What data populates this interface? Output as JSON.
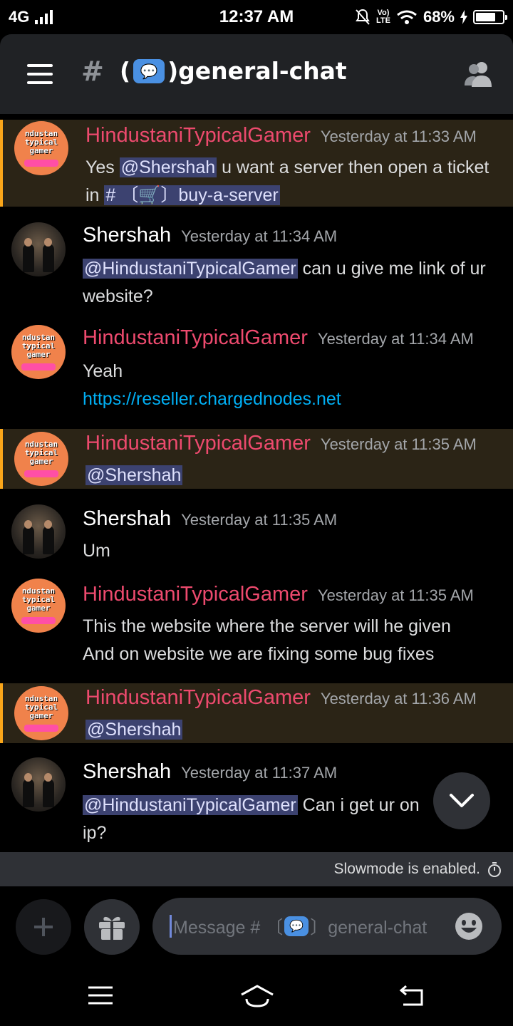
{
  "status_bar": {
    "network": "4G",
    "time": "12:37 AM",
    "volte_top": "Vo)",
    "volte_bottom": "LTE",
    "battery": "68%"
  },
  "header": {
    "hash_symbol": "#",
    "channel_prefix": "(",
    "channel_emoji": "💬",
    "channel_suffix": ")general-chat"
  },
  "messages": [
    {
      "author": "HindustaniTypicalGamer",
      "time": "Yesterday at 11:33 AM",
      "mention": true,
      "parts": [
        "Yes ",
        "@Shershah",
        "  u want a server then open a ticket in ",
        "# 〔🛒〕buy-a-server"
      ]
    },
    {
      "author": "Shershah",
      "time": "Yesterday at 11:34 AM",
      "mention": false,
      "parts": [
        "@HindustaniTypicalGamer",
        " can u give me link of ur website?"
      ]
    },
    {
      "author": "HindustaniTypicalGamer",
      "time": "Yesterday at 11:34 AM",
      "mention": false,
      "line1": "Yeah",
      "link": "https://reseller.chargednodes.net"
    },
    {
      "author": "HindustaniTypicalGamer",
      "time": "Yesterday at 11:35 AM",
      "mention": true,
      "parts": [
        "@Shershah"
      ]
    },
    {
      "author": "Shershah",
      "time": "Yesterday at 11:35 AM",
      "mention": false,
      "text": "Um"
    },
    {
      "author": "HindustaniTypicalGamer",
      "time": "Yesterday at 11:35 AM",
      "mention": false,
      "line1": "This the website where the server will he given",
      "line2": "And on website we are fixing some bug fixes"
    },
    {
      "author": "HindustaniTypicalGamer",
      "time": "Yesterday at 11:36 AM",
      "mention": true,
      "parts": [
        "@Shershah"
      ]
    },
    {
      "author": "Shershah",
      "time": "Yesterday at 11:37 AM",
      "mention": false,
      "parts": [
        "@HindustaniTypicalGamer",
        " Can i get ur on",
        "e",
        "ip?"
      ]
    }
  ],
  "avatar_text": {
    "line1": "ndustan",
    "line2": "typical",
    "line3": "gamer"
  },
  "slowmode_text": "Slowmode is enabled.",
  "composer": {
    "placeholder_start": "Message # 〔",
    "placeholder_emoji": "💬",
    "placeholder_end": "〕general-chat"
  },
  "colors": {
    "username_htg": "#ed4a6e",
    "mention_bg": "#2b2416",
    "mention_bar": "#faa61a",
    "link": "#00aff4",
    "pill_bg": "#3c4270"
  },
  "icons": {
    "menu": "hamburger-icon",
    "members": "members-icon",
    "scroll": "chevron-down-icon",
    "attach": "plus-icon",
    "gift": "gift-icon",
    "emoji": "emoji-icon",
    "slowmode": "timer-icon"
  }
}
